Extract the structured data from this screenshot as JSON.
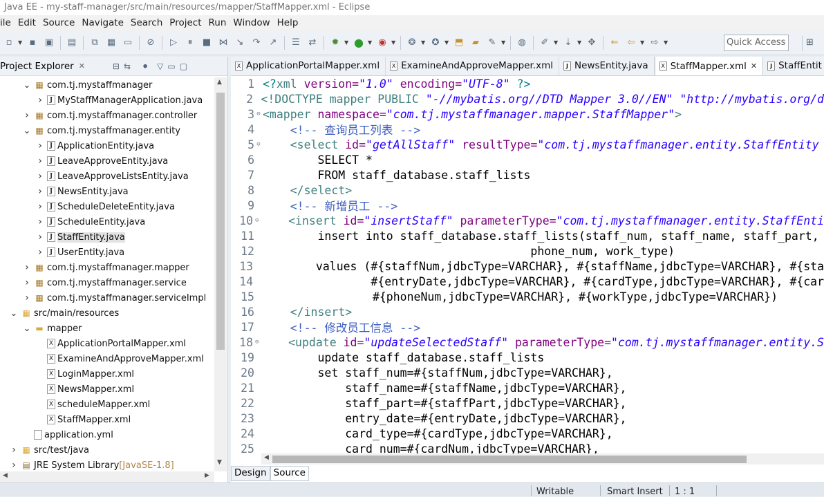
{
  "window": {
    "title": "Java EE - my-staff-manager/src/main/resources/mapper/StaffMapper.xml - Eclipse"
  },
  "menu": [
    "ile",
    "Edit",
    "Source",
    "Navigate",
    "Search",
    "Project",
    "Run",
    "Window",
    "Help"
  ],
  "toolbar": {
    "quick_access": "Quick Access"
  },
  "explorer": {
    "title": "Project Explorer",
    "items": [
      {
        "label": "com.tj.mystaffmanager",
        "icon": "package-icon",
        "indent": 1,
        "twisty": "open"
      },
      {
        "label": "MyStaffManagerApplication.java",
        "icon": "java-file-icon",
        "indent": 2,
        "twisty": "closed"
      },
      {
        "label": "com.tj.mystaffmanager.controller",
        "icon": "package-icon",
        "indent": 1,
        "twisty": "closed"
      },
      {
        "label": "com.tj.mystaffmanager.entity",
        "icon": "package-icon",
        "indent": 1,
        "twisty": "open"
      },
      {
        "label": "ApplicationEntity.java",
        "icon": "java-file-icon",
        "indent": 2,
        "twisty": "closed"
      },
      {
        "label": "LeaveApproveEntity.java",
        "icon": "java-file-icon",
        "indent": 2,
        "twisty": "closed"
      },
      {
        "label": "LeaveApproveListsEntity.java",
        "icon": "java-file-icon",
        "indent": 2,
        "twisty": "closed"
      },
      {
        "label": "NewsEntity.java",
        "icon": "java-file-icon",
        "indent": 2,
        "twisty": "closed"
      },
      {
        "label": "ScheduleDeleteEntity.java",
        "icon": "java-file-icon",
        "indent": 2,
        "twisty": "closed"
      },
      {
        "label": "ScheduleEntity.java",
        "icon": "java-file-icon",
        "indent": 2,
        "twisty": "closed"
      },
      {
        "label": "StaffEntity.java",
        "icon": "java-file-icon",
        "indent": 2,
        "twisty": "closed",
        "selected": true
      },
      {
        "label": "UserEntity.java",
        "icon": "java-file-icon",
        "indent": 2,
        "twisty": "closed"
      },
      {
        "label": "com.tj.mystaffmanager.mapper",
        "icon": "package-icon",
        "indent": 1,
        "twisty": "closed"
      },
      {
        "label": "com.tj.mystaffmanager.service",
        "icon": "package-icon",
        "indent": 1,
        "twisty": "closed"
      },
      {
        "label": "com.tj.mystaffmanager.serviceImpl",
        "icon": "package-icon",
        "indent": 1,
        "twisty": "closed"
      },
      {
        "label": "src/main/resources",
        "icon": "source-folder-icon",
        "indent": 0,
        "twisty": "open"
      },
      {
        "label": "mapper",
        "icon": "folder-icon",
        "indent": 1,
        "twisty": "open"
      },
      {
        "label": "ApplicationPortalMapper.xml",
        "icon": "xml-file-icon",
        "indent": 2,
        "twisty": "none"
      },
      {
        "label": "ExamineAndApproveMapper.xml",
        "icon": "xml-file-icon",
        "indent": 2,
        "twisty": "none"
      },
      {
        "label": "LoginMapper.xml",
        "icon": "xml-file-icon",
        "indent": 2,
        "twisty": "none"
      },
      {
        "label": "NewsMapper.xml",
        "icon": "xml-file-icon",
        "indent": 2,
        "twisty": "none"
      },
      {
        "label": "scheduleMapper.xml",
        "icon": "xml-file-icon",
        "indent": 2,
        "twisty": "none"
      },
      {
        "label": "StaffMapper.xml",
        "icon": "xml-file-icon",
        "indent": 2,
        "twisty": "none"
      },
      {
        "label": "application.yml",
        "icon": "yml-file-icon",
        "indent": 1,
        "twisty": "none"
      },
      {
        "label": "src/test/java",
        "icon": "source-folder-icon",
        "indent": 0,
        "twisty": "closed"
      },
      {
        "label": "JRE System Library",
        "suffix": "[JavaSE-1.8]",
        "icon": "library-icon",
        "indent": 0,
        "twisty": "closed"
      }
    ]
  },
  "editor": {
    "tabs": [
      {
        "label": "ApplicationPortalMapper.xml",
        "icon": "xml-file-icon",
        "active": false
      },
      {
        "label": "ExamineAndApproveMapper.xml",
        "icon": "xml-file-icon",
        "active": false
      },
      {
        "label": "NewsEntity.java",
        "icon": "java-file-icon",
        "active": false
      },
      {
        "label": "StaffMapper.xml",
        "icon": "xml-file-icon",
        "active": true
      },
      {
        "label": "StaffEntit",
        "icon": "java-file-icon",
        "active": false
      }
    ],
    "lines": [
      {
        "n": "1",
        "fold": "",
        "tokens": [
          [
            "pi",
            "<?"
          ],
          [
            "kw",
            "xml "
          ],
          [
            "att",
            "version="
          ],
          [
            "sv",
            "\"1.0\""
          ],
          [
            "tx",
            " "
          ],
          [
            "att",
            "encoding="
          ],
          [
            "sv",
            "\"UTF-8\""
          ],
          [
            "tx",
            " "
          ],
          [
            "pi",
            "?>"
          ]
        ]
      },
      {
        "n": "2",
        "fold": "",
        "tokens": [
          [
            "kw",
            "<!DOCTYPE mapper PUBLIC "
          ],
          [
            "sv",
            "\"-//mybatis.org//DTD Mapper 3.0//EN\""
          ],
          [
            "tx",
            " "
          ],
          [
            "sv",
            "\"http://mybatis.org/d"
          ]
        ]
      },
      {
        "n": "3",
        "fold": "⊖",
        "tokens": [
          [
            "kw",
            "<mapper "
          ],
          [
            "att",
            "namespace="
          ],
          [
            "sv",
            "\"com.tj.mystaffmanager.mapper.StaffMapper\""
          ],
          [
            "kw",
            ">"
          ]
        ]
      },
      {
        "n": "4",
        "fold": "",
        "tokens": [
          [
            "tx",
            "    "
          ],
          [
            "cm",
            "<!-- 查询员工列表 -->"
          ]
        ]
      },
      {
        "n": "5",
        "fold": "⊖",
        "tokens": [
          [
            "tx",
            "    "
          ],
          [
            "kw",
            "<select "
          ],
          [
            "att",
            "id="
          ],
          [
            "sv",
            "\"getAllStaff\""
          ],
          [
            "tx",
            " "
          ],
          [
            "att",
            "resultType="
          ],
          [
            "sv",
            "\"com.tj.mystaffmanager.entity.StaffEntity"
          ]
        ]
      },
      {
        "n": "6",
        "fold": "",
        "tokens": [
          [
            "tx",
            "        SELECT *"
          ]
        ]
      },
      {
        "n": "7",
        "fold": "",
        "tokens": [
          [
            "tx",
            "        FROM staff_database.staff_lists"
          ]
        ]
      },
      {
        "n": "8",
        "fold": "",
        "tokens": [
          [
            "tx",
            "    "
          ],
          [
            "kw",
            "</select>"
          ]
        ]
      },
      {
        "n": "9",
        "fold": "",
        "tokens": [
          [
            "tx",
            "    "
          ],
          [
            "cm",
            "<!-- 新增员工 -->"
          ]
        ]
      },
      {
        "n": "10",
        "fold": "⊖",
        "tokens": [
          [
            "tx",
            "    "
          ],
          [
            "kw",
            "<insert "
          ],
          [
            "att",
            "id="
          ],
          [
            "sv",
            "\"insertStaff\""
          ],
          [
            "tx",
            " "
          ],
          [
            "att",
            "parameterType="
          ],
          [
            "sv",
            "\"com.tj.mystaffmanager.entity.StaffEnti"
          ]
        ]
      },
      {
        "n": "11",
        "fold": "",
        "tokens": [
          [
            "tx",
            "        insert into staff_database.staff_lists(staff_num, staff_name, staff_part,"
          ]
        ]
      },
      {
        "n": "12",
        "fold": "",
        "tokens": [
          [
            "tx",
            "                                       phone_num, work_type)"
          ]
        ]
      },
      {
        "n": "13",
        "fold": "",
        "tokens": [
          [
            "tx",
            "        values (#{staffNum,jdbcType=VARCHAR}, #{staffName,jdbcType=VARCHAR}, #{sta"
          ]
        ]
      },
      {
        "n": "14",
        "fold": "",
        "tokens": [
          [
            "tx",
            "                #{entryDate,jdbcType=VARCHAR}, #{cardType,jdbcType=VARCHAR}, #{car"
          ]
        ]
      },
      {
        "n": "15",
        "fold": "",
        "tokens": [
          [
            "tx",
            "                #{phoneNum,jdbcType=VARCHAR}, #{workType,jdbcType=VARCHAR})"
          ]
        ]
      },
      {
        "n": "16",
        "fold": "",
        "tokens": [
          [
            "tx",
            "    "
          ],
          [
            "kw",
            "</insert>"
          ]
        ]
      },
      {
        "n": "17",
        "fold": "",
        "tokens": [
          [
            "tx",
            "    "
          ],
          [
            "cm",
            "<!-- 修改员工信息 -->"
          ]
        ]
      },
      {
        "n": "18",
        "fold": "⊖",
        "tokens": [
          [
            "tx",
            "    "
          ],
          [
            "kw",
            "<update "
          ],
          [
            "att",
            "id="
          ],
          [
            "sv",
            "\"updateSelectedStaff\""
          ],
          [
            "tx",
            " "
          ],
          [
            "att",
            "parameterType="
          ],
          [
            "sv",
            "\"com.tj.mystaffmanager.entity.S"
          ]
        ]
      },
      {
        "n": "19",
        "fold": "",
        "tokens": [
          [
            "tx",
            "        update staff_database.staff_lists"
          ]
        ]
      },
      {
        "n": "20",
        "fold": "",
        "tokens": [
          [
            "tx",
            "        set staff_num=#{staffNum,jdbcType=VARCHAR},"
          ]
        ]
      },
      {
        "n": "21",
        "fold": "",
        "tokens": [
          [
            "tx",
            "            staff_name=#{staffName,jdbcType=VARCHAR},"
          ]
        ]
      },
      {
        "n": "22",
        "fold": "",
        "tokens": [
          [
            "tx",
            "            staff_part=#{staffPart,jdbcType=VARCHAR},"
          ]
        ]
      },
      {
        "n": "23",
        "fold": "",
        "tokens": [
          [
            "tx",
            "            entry_date=#{entryDate,jdbcType=VARCHAR},"
          ]
        ]
      },
      {
        "n": "24",
        "fold": "",
        "tokens": [
          [
            "tx",
            "            card_type=#{cardType,jdbcType=VARCHAR},"
          ]
        ]
      },
      {
        "n": "25",
        "fold": "",
        "tokens": [
          [
            "tx",
            "            card_num=#{cardNum,jdbcType=VARCHAR},"
          ]
        ]
      }
    ],
    "bottom_tabs": [
      {
        "label": "Design",
        "active": false
      },
      {
        "label": "Source",
        "active": true
      }
    ]
  },
  "status": {
    "writable": "Writable",
    "insert_mode": "Smart Insert",
    "position": "1 : 1"
  }
}
